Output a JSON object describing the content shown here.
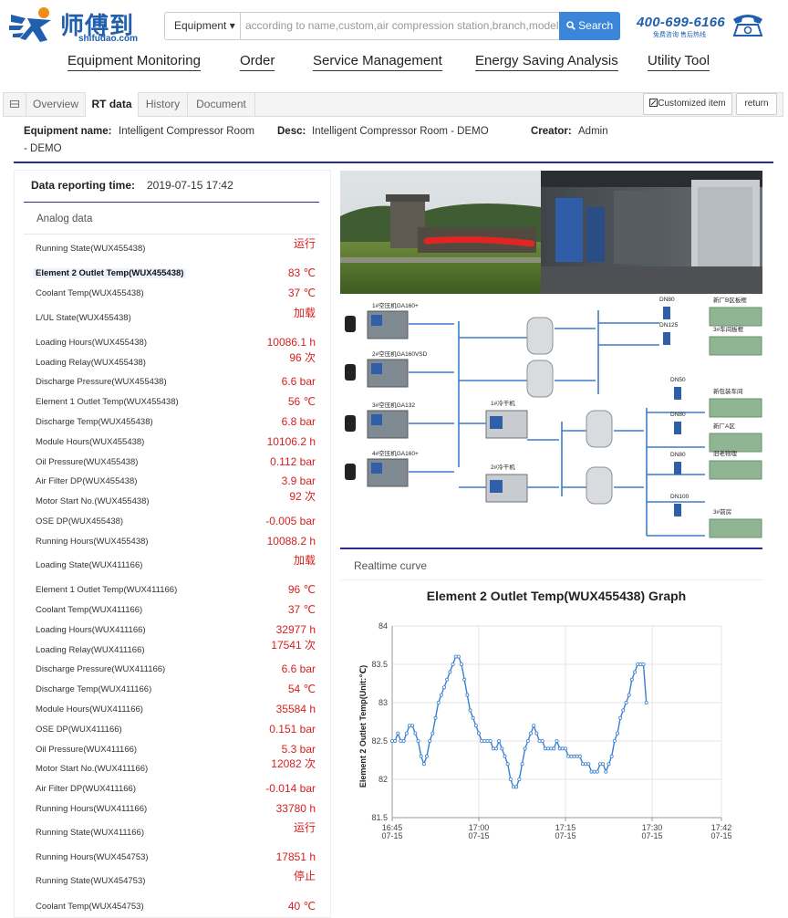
{
  "header": {
    "logo_cn": "师傅到",
    "logo_url": "shifudao.com",
    "search_select": "Equipment ▾",
    "search_placeholder": "according to name,custom,air compression station,branch,model,esn",
    "search_button": "Search",
    "hotline": "400-699-6166",
    "hotline_sub": "免费咨询  售后热线"
  },
  "nav": [
    "Equipment Monitoring",
    "Order",
    "Service Management",
    "Energy Saving Analysis",
    "Utility Tool"
  ],
  "tabs": {
    "items": [
      "Overview",
      "RT data",
      "History",
      "Document"
    ],
    "active": "RT data",
    "customized_button": "Customized item",
    "return_button": "return"
  },
  "equipment": {
    "name_label": "Equipment name:",
    "name": "Intelligent Compressor Room",
    "name_cont": "- DEMO",
    "desc_label": "Desc:",
    "desc": "Intelligent Compressor Room - DEMO",
    "creator_label": "Creator:",
    "creator": "Admin"
  },
  "report": {
    "label": "Data reporting time:",
    "time": "2019-07-15 17:42",
    "analog_title": "Analog data"
  },
  "rows": [
    {
      "name": "Running State(WUX455438)",
      "value": "运行"
    },
    {
      "name": "Element 2 Outlet Temp(WUX455438)",
      "value": "83 ℃",
      "highlight": true
    },
    {
      "name": "Coolant Temp(WUX455438)",
      "value": "37 ℃"
    },
    {
      "name": "L/UL State(WUX455438)",
      "value": "加载"
    },
    {
      "name": "Loading Hours(WUX455438)",
      "value": "10086.1 h"
    },
    {
      "name": "Loading Relay(WUX455438)",
      "value": "96 次"
    },
    {
      "name": "Discharge Pressure(WUX455438)",
      "value": "6.6 bar"
    },
    {
      "name": "Element 1 Outlet Temp(WUX455438)",
      "value": "56 ℃"
    },
    {
      "name": "Discharge Temp(WUX455438)",
      "value": "6.8 bar"
    },
    {
      "name": "Module Hours(WUX455438)",
      "value": "10106.2 h"
    },
    {
      "name": "Oil Pressure(WUX455438)",
      "value": "0.112 bar"
    },
    {
      "name": "Air Filter DP(WUX455438)",
      "value": "3.9 bar"
    },
    {
      "name": "Motor Start No.(WUX455438)",
      "value": "92 次"
    },
    {
      "name": "OSE DP(WUX455438)",
      "value": "-0.005 bar"
    },
    {
      "name": "Running Hours(WUX455438)",
      "value": "10088.2 h"
    },
    {
      "name": "Loading State(WUX411166)",
      "value": "加载"
    },
    {
      "name": "Element 1 Outlet Temp(WUX411166)",
      "value": "96 ℃"
    },
    {
      "name": "Coolant Temp(WUX411166)",
      "value": "37 ℃"
    },
    {
      "name": "Loading Hours(WUX411166)",
      "value": "32977 h"
    },
    {
      "name": "Loading Relay(WUX411166)",
      "value": "17541 次"
    },
    {
      "name": "Discharge Pressure(WUX411166)",
      "value": "6.6 bar"
    },
    {
      "name": "Discharge Temp(WUX411166)",
      "value": "54 ℃"
    },
    {
      "name": "Module Hours(WUX411166)",
      "value": "35584 h"
    },
    {
      "name": "OSE DP(WUX411166)",
      "value": "0.151 bar"
    },
    {
      "name": "Oil Pressure(WUX411166)",
      "value": "5.3 bar"
    },
    {
      "name": "Motor Start No.(WUX411166)",
      "value": "12082 次"
    },
    {
      "name": "Air Filter DP(WUX411166)",
      "value": "-0.014 bar"
    },
    {
      "name": "Running Hours(WUX411166)",
      "value": "33780 h"
    },
    {
      "name": "Running State(WUX411166)",
      "value": "运行"
    },
    {
      "name": "Running Hours(WUX454753)",
      "value": "17851 h"
    },
    {
      "name": "Running State(WUX454753)",
      "value": "停止"
    },
    {
      "name": "Coolant Temp(WUX454753)",
      "value": "40 ℃"
    }
  ],
  "diagram": {
    "compressors": [
      "1#空压机GA160+",
      "2#空压机GA160VSD",
      "3#空压机GA132",
      "4#空压机GA160+"
    ],
    "dryers": [
      "1#冷干机",
      "2#冷干机"
    ],
    "flows": [
      "DN80",
      "DN125",
      "DN50",
      "DN80",
      "DN80",
      "DN100"
    ],
    "workshops": [
      "新厂B区板框",
      "3#车间板框",
      "新包装车间",
      "新厂A区",
      "旧老物理",
      "3#前房"
    ]
  },
  "curve": {
    "tab_label": "Realtime curve"
  },
  "chart_data": {
    "type": "line",
    "title": "Element 2 Outlet Temp(WUX455438) Graph",
    "ylabel": "Element 2 Outlet Temp(Unit:℃)",
    "xlabel": "",
    "ylim": [
      81.5,
      84
    ],
    "yticks": [
      81.5,
      82,
      82.5,
      83,
      83.5,
      84
    ],
    "xticks": [
      {
        "t": 0,
        "label": "16:45",
        "sub": "07-15"
      },
      {
        "t": 15,
        "label": "17:00",
        "sub": "07-15"
      },
      {
        "t": 30,
        "label": "17:15",
        "sub": "07-15"
      },
      {
        "t": 45,
        "label": "17:30",
        "sub": "07-15"
      },
      {
        "t": 57,
        "label": "17:42",
        "sub": "07-15"
      }
    ],
    "series": [
      {
        "color": "#3b7fd0",
        "points": [
          [
            0,
            82.5
          ],
          [
            0.5,
            82.5
          ],
          [
            1,
            82.6
          ],
          [
            1.5,
            82.5
          ],
          [
            2,
            82.5
          ],
          [
            2.5,
            82.6
          ],
          [
            3,
            82.7
          ],
          [
            3.5,
            82.7
          ],
          [
            4,
            82.6
          ],
          [
            4.5,
            82.5
          ],
          [
            5,
            82.3
          ],
          [
            5.5,
            82.2
          ],
          [
            6,
            82.3
          ],
          [
            6.5,
            82.5
          ],
          [
            7,
            82.6
          ],
          [
            7.5,
            82.8
          ],
          [
            8,
            83.0
          ],
          [
            8.5,
            83.1
          ],
          [
            9,
            83.2
          ],
          [
            9.5,
            83.3
          ],
          [
            10,
            83.4
          ],
          [
            10.5,
            83.5
          ],
          [
            11,
            83.6
          ],
          [
            11.5,
            83.6
          ],
          [
            12,
            83.5
          ],
          [
            12.5,
            83.3
          ],
          [
            13,
            83.1
          ],
          [
            13.5,
            82.9
          ],
          [
            14,
            82.8
          ],
          [
            14.5,
            82.7
          ],
          [
            15,
            82.6
          ],
          [
            15.5,
            82.5
          ],
          [
            16,
            82.5
          ],
          [
            16.5,
            82.5
          ],
          [
            17,
            82.5
          ],
          [
            17.5,
            82.4
          ],
          [
            18,
            82.4
          ],
          [
            18.5,
            82.5
          ],
          [
            19,
            82.4
          ],
          [
            19.5,
            82.3
          ],
          [
            20,
            82.2
          ],
          [
            20.5,
            82.0
          ],
          [
            21,
            81.9
          ],
          [
            21.5,
            81.9
          ],
          [
            22,
            82.0
          ],
          [
            22.5,
            82.2
          ],
          [
            23,
            82.4
          ],
          [
            23.5,
            82.5
          ],
          [
            24,
            82.6
          ],
          [
            24.5,
            82.7
          ],
          [
            25,
            82.6
          ],
          [
            25.5,
            82.5
          ],
          [
            26,
            82.5
          ],
          [
            26.5,
            82.4
          ],
          [
            27,
            82.4
          ],
          [
            27.5,
            82.4
          ],
          [
            28,
            82.4
          ],
          [
            28.5,
            82.5
          ],
          [
            29,
            82.4
          ],
          [
            29.5,
            82.4
          ],
          [
            30,
            82.4
          ],
          [
            30.5,
            82.3
          ],
          [
            31,
            82.3
          ],
          [
            31.5,
            82.3
          ],
          [
            32,
            82.3
          ],
          [
            32.5,
            82.3
          ],
          [
            33,
            82.2
          ],
          [
            33.5,
            82.2
          ],
          [
            34,
            82.2
          ],
          [
            34.5,
            82.1
          ],
          [
            35,
            82.1
          ],
          [
            35.5,
            82.1
          ],
          [
            36,
            82.2
          ],
          [
            36.5,
            82.2
          ],
          [
            37,
            82.1
          ],
          [
            37.5,
            82.2
          ],
          [
            38,
            82.3
          ],
          [
            38.5,
            82.5
          ],
          [
            39,
            82.6
          ],
          [
            39.5,
            82.8
          ],
          [
            40,
            82.9
          ],
          [
            40.5,
            83.0
          ],
          [
            41,
            83.1
          ],
          [
            41.5,
            83.3
          ],
          [
            42,
            83.4
          ],
          [
            42.5,
            83.5
          ],
          [
            43,
            83.5
          ],
          [
            43.5,
            83.5
          ],
          [
            44,
            83.0
          ]
        ]
      }
    ]
  }
}
